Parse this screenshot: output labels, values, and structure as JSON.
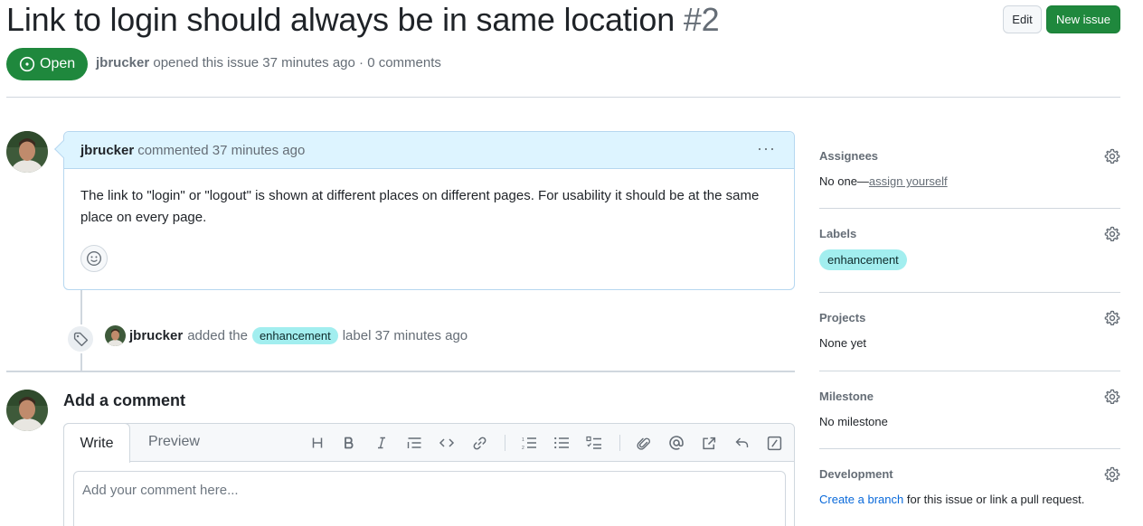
{
  "issue": {
    "title": "Link to login should always be in same location",
    "number": "#2",
    "state": "Open",
    "author": "jbrucker",
    "meta_suffix": "opened this issue 37 minutes ago · 0 comments"
  },
  "header": {
    "edit_label": "Edit",
    "new_issue_label": "New issue"
  },
  "comment": {
    "author": "jbrucker",
    "time_text": "commented 37 minutes ago",
    "menu_glyph": "···",
    "body": "The link to \"login\" or \"logout\" is shown at different places on different pages. For usability it should be at the same place on every page."
  },
  "event": {
    "author": "jbrucker",
    "action": "added the",
    "label": "enhancement",
    "suffix": "label 37 minutes ago"
  },
  "new_comment": {
    "heading": "Add a comment",
    "tab_write": "Write",
    "tab_preview": "Preview",
    "placeholder": "Add your comment here..."
  },
  "sidebar": {
    "assignees": {
      "title": "Assignees",
      "value_prefix": "No one—",
      "value_link": "assign yourself"
    },
    "labels": {
      "title": "Labels",
      "label": "enhancement"
    },
    "projects": {
      "title": "Projects",
      "value": "None yet"
    },
    "milestone": {
      "title": "Milestone",
      "value": "No milestone"
    },
    "development": {
      "title": "Development",
      "link": "Create a branch",
      "suffix": " for this issue or link a pull request."
    }
  },
  "colors": {
    "open_green": "#1f883d",
    "label_bg": "#a2eeef",
    "link_blue": "#0969da",
    "comment_header": "#ddf4ff"
  }
}
